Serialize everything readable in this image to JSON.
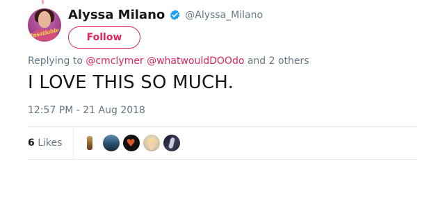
{
  "author": {
    "display_name": "Alyssa Milano",
    "handle": "@Alyssa_Milano",
    "verified": true,
    "avatar_logo_text": "Insatiable"
  },
  "follow_button": {
    "label": "Follow"
  },
  "reply": {
    "prefix": "Replying to",
    "mentions": [
      "@cmclymer",
      "@whatwouldDOOdo"
    ],
    "suffix": "and 2 others"
  },
  "tweet": {
    "text": "I LOVE THIS SO MUCH.",
    "timestamp": "12:57 PM - 21 Aug 2018"
  },
  "stats": {
    "likes_count": "6",
    "likes_label": "Likes"
  },
  "colors": {
    "accent": "#e0245e",
    "secondary_text": "#657786",
    "primary_text": "#14171a",
    "verified": "#1da1f2",
    "divider": "#e6ecf0"
  }
}
